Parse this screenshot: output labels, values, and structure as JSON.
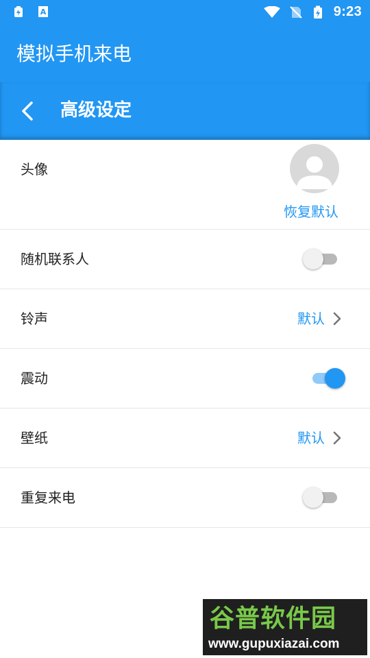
{
  "status_bar": {
    "time": "9:23",
    "left_icons": [
      "battery-saver-icon",
      "a-icon"
    ],
    "right_icons": [
      "wifi-icon",
      "no-sim-icon",
      "battery-charging-icon"
    ]
  },
  "app_bar": {
    "title": "模拟手机来电"
  },
  "sub_bar": {
    "title": "高级设定",
    "back_icon": "chevron-left-icon"
  },
  "settings": {
    "avatar": {
      "label": "头像",
      "restore_label": "恢复默认"
    },
    "random_contact": {
      "label": "随机联系人",
      "enabled": false
    },
    "ringtone": {
      "label": "铃声",
      "value": "默认"
    },
    "vibration": {
      "label": "震动",
      "enabled": true
    },
    "wallpaper": {
      "label": "壁纸",
      "value": "默认"
    },
    "repeat_call": {
      "label": "重复来电",
      "enabled": false
    }
  },
  "watermark": {
    "brand": "谷普软件园",
    "url": "www.gupuxiazai.com"
  },
  "colors": {
    "primary": "#2196F3",
    "switch_on_track": "#90CAF9",
    "switch_off_track": "#B8B8B8"
  }
}
